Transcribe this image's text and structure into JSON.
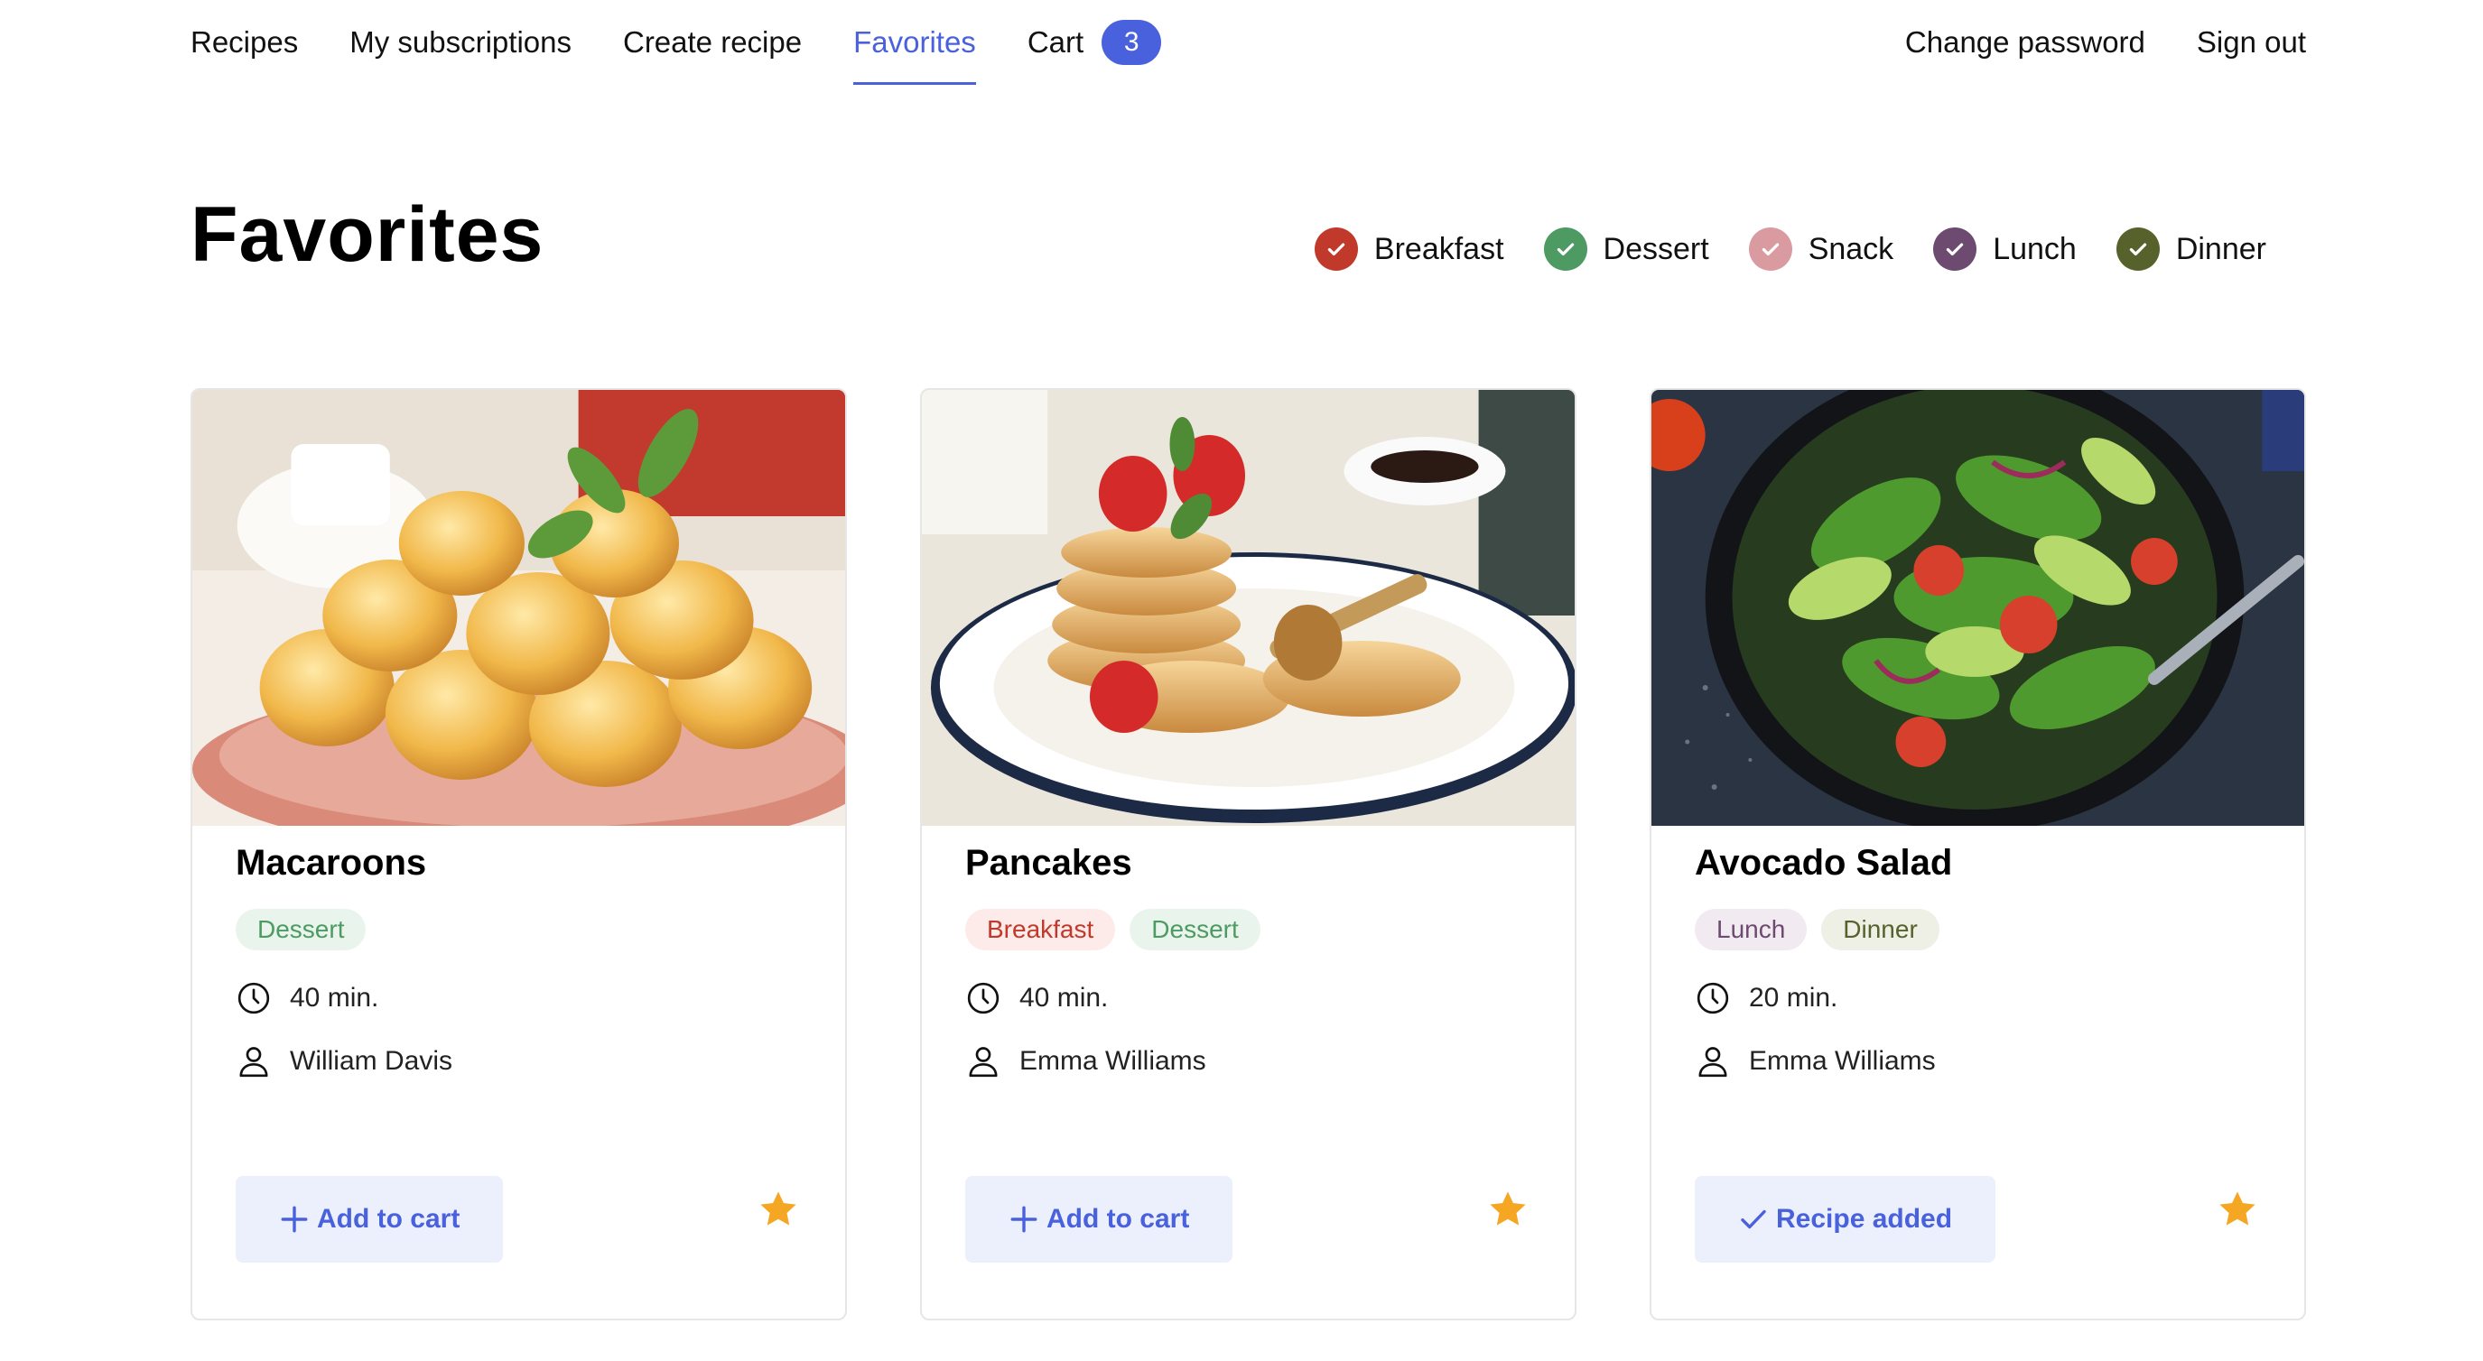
{
  "nav": {
    "items": [
      {
        "label": "Recipes",
        "active": false
      },
      {
        "label": "My subscriptions",
        "active": false
      },
      {
        "label": "Create recipe",
        "active": false
      },
      {
        "label": "Favorites",
        "active": true
      }
    ],
    "cart_label": "Cart",
    "cart_count": "3",
    "change_password": "Change password",
    "sign_out": "Sign out",
    "accent_color": "#4a61dd"
  },
  "page": {
    "title": "Favorites"
  },
  "filters": [
    {
      "label": "Breakfast",
      "color": "#c0392b",
      "checked": true
    },
    {
      "label": "Dessert",
      "color": "#4e9a63",
      "checked": true
    },
    {
      "label": "Snack",
      "color": "#d99ba0",
      "checked": true
    },
    {
      "label": "Lunch",
      "color": "#6d4a6f",
      "checked": true
    },
    {
      "label": "Dinner",
      "color": "#56612c",
      "checked": true
    }
  ],
  "recipes": [
    {
      "title": "Macaroons",
      "tags": [
        "Dessert"
      ],
      "time": "40 min.",
      "author": "William Davis",
      "cart_button": "Add to cart",
      "cart_icon": "plus-icon",
      "favorite": true
    },
    {
      "title": "Pancakes",
      "tags": [
        "Breakfast",
        "Dessert"
      ],
      "time": "40 min.",
      "author": "Emma Williams",
      "cart_button": "Add to cart",
      "cart_icon": "plus-icon",
      "favorite": true
    },
    {
      "title": "Avocado Salad",
      "tags": [
        "Lunch",
        "Dinner"
      ],
      "time": "20 min.",
      "author": "Emma Williams",
      "cart_button": "Recipe added",
      "cart_icon": "check-icon",
      "favorite": true
    }
  ],
  "colors": {
    "star": "#f5a623"
  }
}
